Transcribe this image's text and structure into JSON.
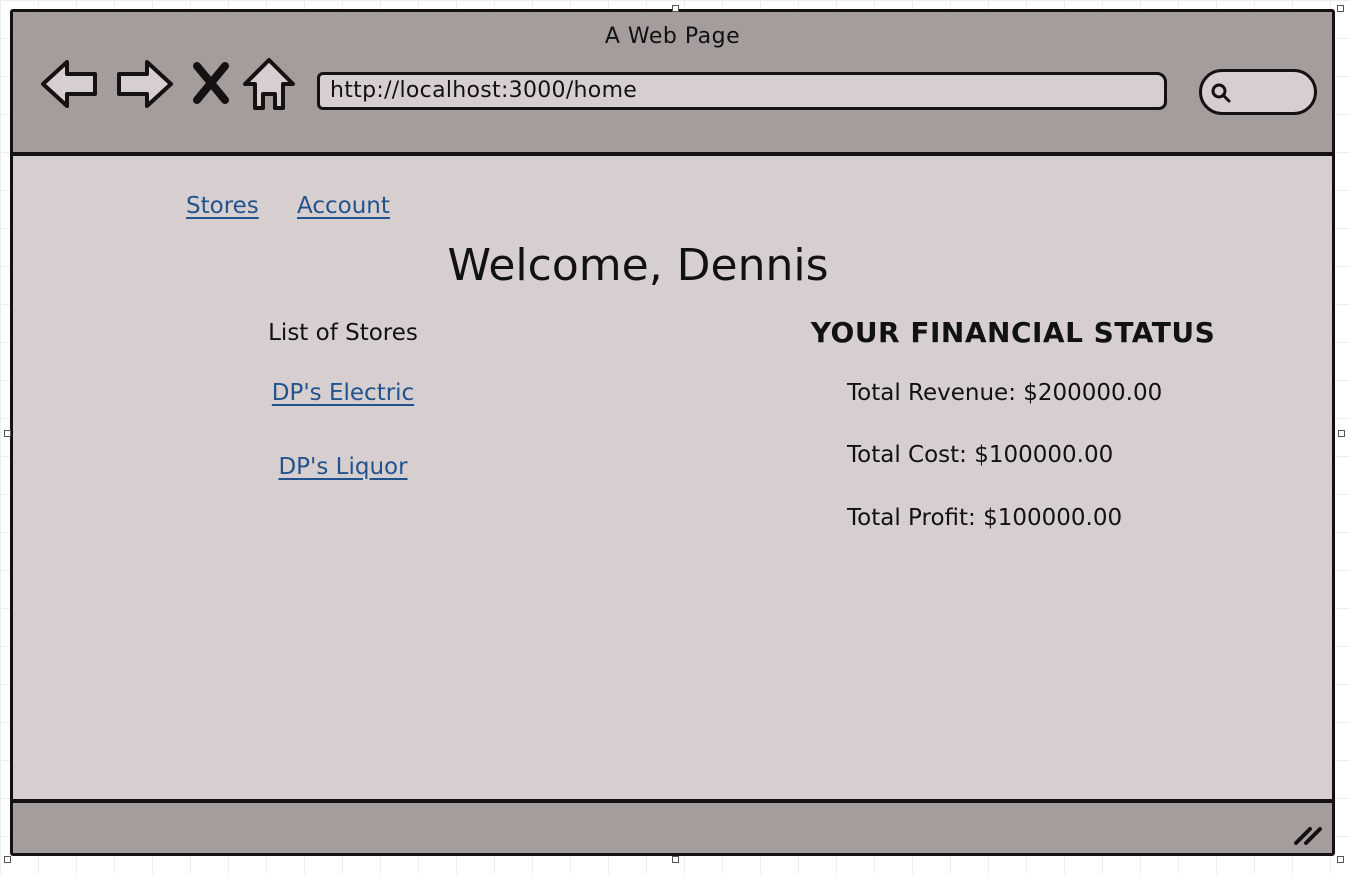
{
  "window": {
    "title": "A Web Page"
  },
  "toolbar": {
    "back_icon": "back-arrow-icon",
    "forward_icon": "forward-arrow-icon",
    "stop_icon": "close-icon",
    "home_icon": "home-icon",
    "url": "http://localhost:3000/home",
    "search_icon": "search-icon"
  },
  "nav": {
    "links": [
      "Stores",
      "Account"
    ]
  },
  "main": {
    "welcome": "Welcome, Dennis"
  },
  "stores": {
    "heading": "List of Stores",
    "items": [
      "DP's Electric",
      "DP's Liquor"
    ]
  },
  "financial": {
    "heading": "YOUR FINANCIAL STATUS",
    "lines": [
      "Total Revenue: $200000.00",
      "Total Cost: $100000.00",
      "Total Profit: $100000.00"
    ]
  },
  "colors": {
    "chrome": "#a59d9c",
    "page_bg": "#d7cfcf",
    "link": "#21538f",
    "outline": "#151111"
  }
}
